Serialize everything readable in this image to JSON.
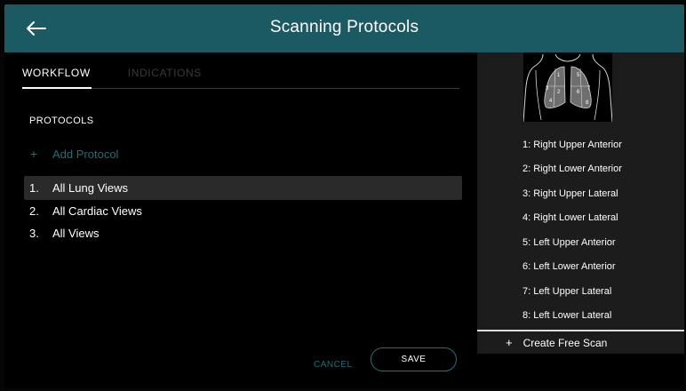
{
  "header": {
    "title": "Scanning Protocols",
    "back_icon": "arrow-left-icon"
  },
  "tabs": [
    {
      "label": "WORKFLOW",
      "active": true
    },
    {
      "label": "INDICATIONS",
      "active": false
    }
  ],
  "protocols": {
    "section_label": "PROTOCOLS",
    "add_label": "Add Protocol",
    "add_icon": "plus-icon",
    "items": [
      {
        "num": "1.",
        "label": "All Lung Views",
        "selected": true
      },
      {
        "num": "2.",
        "label": "All Cardiac Views",
        "selected": false
      },
      {
        "num": "3.",
        "label": "All Views",
        "selected": false
      }
    ]
  },
  "actions": {
    "cancel_label": "CANCEL",
    "save_label": "SAVE"
  },
  "diagram": {
    "zones": [
      "1",
      "2",
      "3",
      "4",
      "5",
      "6",
      "7",
      "8"
    ]
  },
  "regions": [
    "1: Right Upper Anterior",
    "2: Right Lower Anterior",
    "3: Right Upper Lateral",
    "4: Right Lower Lateral",
    "5: Left Upper Anterior",
    "6: Left Lower Anterior",
    "7: Left Upper Lateral",
    "8: Left Lower Lateral"
  ],
  "free_scan": {
    "label": "Create Free Scan",
    "icon": "plus-icon"
  },
  "colors": {
    "header_bg": "#1b5a63",
    "accent": "#1f6f78",
    "panel_bg": "#1c1c1c",
    "selected_row": "#2a2a2a"
  }
}
